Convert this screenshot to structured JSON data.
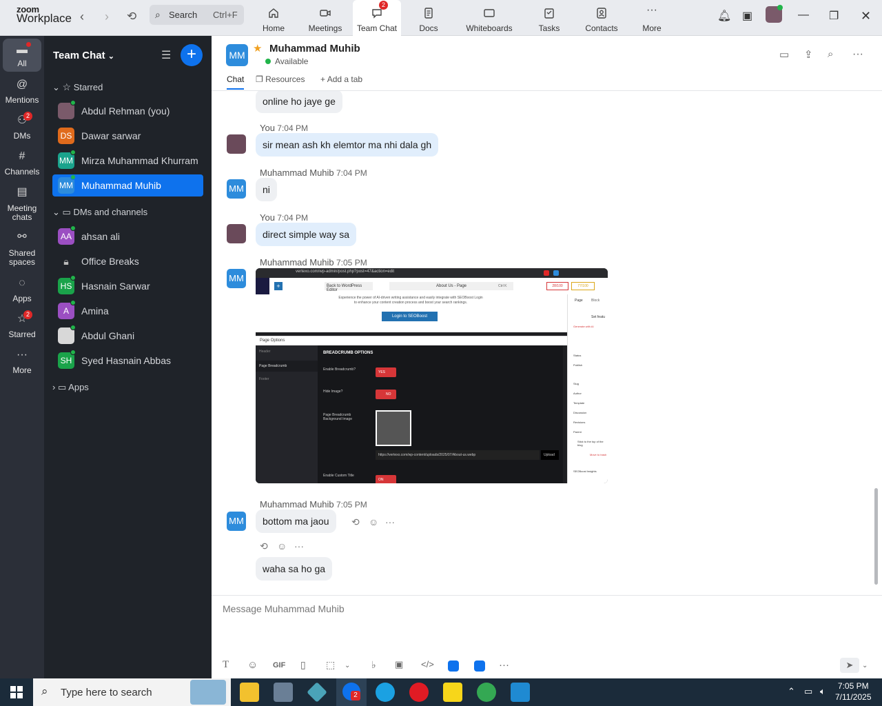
{
  "app": {
    "brand_top": "zoom",
    "brand_bottom": "Workplace"
  },
  "search": {
    "label": "Search",
    "shortcut": "Ctrl+F"
  },
  "tabs": [
    {
      "label": "Home",
      "icon": "home-icon"
    },
    {
      "label": "Meetings",
      "icon": "video-icon"
    },
    {
      "label": "Team Chat",
      "icon": "chat-icon",
      "badge": "2"
    },
    {
      "label": "Docs",
      "icon": "doc-icon"
    },
    {
      "label": "Whiteboards",
      "icon": "whiteboard-icon"
    },
    {
      "label": "Tasks",
      "icon": "tasks-icon"
    },
    {
      "label": "Contacts",
      "icon": "contacts-icon"
    },
    {
      "label": "More",
      "icon": "more-icon"
    }
  ],
  "rail": {
    "all": "All",
    "mentions": "Mentions",
    "dms": "DMs",
    "dms_badge": "2",
    "channels": "Channels",
    "meeting_chats_1": "Meeting",
    "meeting_chats_2": "chats",
    "shared_1": "Shared",
    "shared_2": "spaces",
    "apps": "Apps",
    "starred": "Starred",
    "starred_badge": "2",
    "more": "More"
  },
  "sidebar": {
    "title": "Team Chat",
    "starred_section": "Starred",
    "dms_section": "DMs and channels",
    "apps_section": "Apps",
    "starred_items": [
      {
        "name": "Abdul Rehman (you)",
        "initials": "",
        "color": "#7a5a6a"
      },
      {
        "name": "Dawar sarwar",
        "initials": "DS",
        "color": "#e06b1c"
      },
      {
        "name": "Mirza Muhammad Khurram",
        "initials": "MM",
        "color": "#1aa38c"
      },
      {
        "name": "Muhammad Muhib",
        "initials": "MM",
        "color": "#2d8cdc"
      }
    ],
    "dm_items": [
      {
        "name": "ahsan ali",
        "initials": "AA",
        "color": "#9b4fc2"
      },
      {
        "name": "Office Breaks",
        "initials": "",
        "color": ""
      },
      {
        "name": "Hasnain Sarwar",
        "initials": "HS",
        "color": "#1aa34a"
      },
      {
        "name": "Amina",
        "initials": "A",
        "color": "#9b4fc2"
      },
      {
        "name": "Abdul Ghani",
        "initials": "",
        "color": "#ddd"
      },
      {
        "name": "Syed Hasnain Abbas",
        "initials": "SH",
        "color": "#1aa34a"
      }
    ]
  },
  "chat_header": {
    "initials": "MM",
    "name": "Muhammad Muhib",
    "status": "Available",
    "tab_chat": "Chat",
    "tab_resources": "Resources",
    "tab_add": "Add a tab"
  },
  "messages": [
    {
      "text": "online ho jaye ge"
    },
    {
      "sender": "You",
      "time": "7:04 PM",
      "text": "sir mean ash kh elemtor ma nhi dala gh"
    },
    {
      "sender": "Muhammad Muhib",
      "time": "7:04 PM",
      "text": "ni"
    },
    {
      "sender": "You",
      "time": "7:04 PM",
      "text": "direct simple way sa"
    },
    {
      "sender": "Muhammad Muhib",
      "time": "7:05 PM",
      "text": ""
    },
    {
      "sender": "Muhammad Muhib",
      "time": "7:05 PM",
      "text": "bottom ma jaou"
    },
    {
      "text": "waha sa ho ga"
    }
  ],
  "attachment": {
    "url_text": "vertexo.com/wp-admin/post.php?post=47&action=edit",
    "back_btn": "Back to WordPress Editor",
    "title_field": "About Us - Page",
    "shortcut": "Ctrl K",
    "login_btn": "Login to SEOBoost",
    "promo_1": "Experience the power of AI-driven writing assistance and easily integrate with SEOBoost Login",
    "promo_2": "to enhance your content creation process and boost your search rankings.",
    "panel_title": "Page Options",
    "side_1": "Header",
    "side_2": "Page Breadcrumb",
    "side_3": "Footer",
    "section_title": "BREADCRUMB OPTIONS",
    "opt_1": "Enable Breadcrumb?",
    "opt_1_val": "YES",
    "opt_2": "Hide Image?",
    "opt_2_val": "NO",
    "opt_3a": "Page Breadcrumb",
    "opt_3b": "Background Image",
    "img_url": "https://vertexo.com/wp-content/uploads/2025/07/About-us.webp",
    "upload": "Upload",
    "opt_4": "Enable Custom Title",
    "opt_4_val": "ON",
    "right_tab_1": "Page",
    "right_tab_2": "Block",
    "right_labels": [
      "Set featu",
      "Generate with AI",
      "Status",
      "Publish",
      "Slug",
      "Author",
      "Template",
      "Discussion",
      "Revisions",
      "Parent",
      "Stick to the top of the blog",
      "Move to trash",
      "SEOBoost Insights"
    ],
    "fields": [
      "Page",
      "Block",
      "Set featured image"
    ],
    "badge_1": "28/100",
    "badge_2": "77/100"
  },
  "composer": {
    "placeholder": "Message Muhammad Muhib"
  },
  "taskbar": {
    "search": "Type here to search",
    "time": "7:05 PM",
    "date": "7/11/2025",
    "zoom_badge": "2"
  }
}
